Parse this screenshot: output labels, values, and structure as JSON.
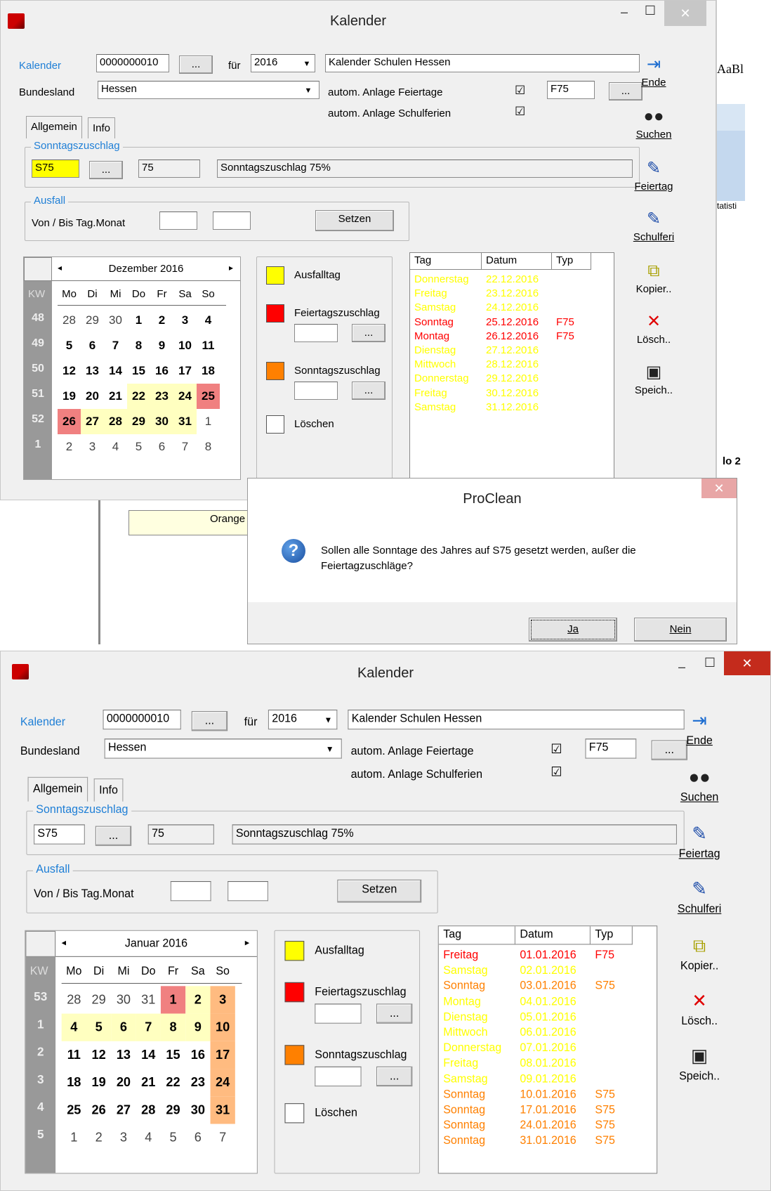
{
  "win1": {
    "title": "Kalender",
    "minimize": "‒",
    "maximize": "☐",
    "close": "✕",
    "kalender_label": "Kalender",
    "kalender_value": "0000000010",
    "browse": "...",
    "fuer_label": "für",
    "year": "2016",
    "name": "Kalender Schulen  Hessen",
    "bundesland_label": "Bundesland",
    "bundesland": "Hessen",
    "feiertage_label": "autom. Anlage Feiertage",
    "feiertage_code": "F75",
    "schulferien_label": "autom. Anlage Schulferien",
    "check": "☑",
    "tab_allgemein": "Allgemein",
    "tab_info": "Info",
    "sonntag_group": "Sonntagszuschlag",
    "sonntag_code": "S75",
    "sonntag_pct": "75",
    "sonntag_desc": "Sonntagszuschlag 75%",
    "ausfall_group": "Ausfall",
    "vonbis": "Von / Bis Tag.Monat",
    "setzen": "Setzen",
    "month": "Dezember 2016",
    "kw": "KW",
    "prev": "◂",
    "next": "▸",
    "weekdays": [
      "Mo",
      "Di",
      "Mi",
      "Do",
      "Fr",
      "Sa",
      "So"
    ],
    "weeks": [
      "48",
      "49",
      "50",
      "51",
      "52",
      "1"
    ],
    "days": [
      [
        "28",
        "29",
        "30",
        "1",
        "2",
        "3",
        "4"
      ],
      [
        "5",
        "6",
        "7",
        "8",
        "9",
        "10",
        "11"
      ],
      [
        "12",
        "13",
        "14",
        "15",
        "16",
        "17",
        "18"
      ],
      [
        "19",
        "20",
        "21",
        "22",
        "23",
        "24",
        "25"
      ],
      [
        "26",
        "27",
        "28",
        "29",
        "30",
        "31",
        "1"
      ],
      [
        "2",
        "3",
        "4",
        "5",
        "6",
        "7",
        "8"
      ]
    ],
    "legend": {
      "ausfall": "Ausfalltag",
      "feiertag": "Feiertagszuschlag",
      "sonntag": "Sonntagszuschlag",
      "loeschen": "Löschen"
    },
    "list_head": [
      "Tag",
      "Datum",
      "Typ"
    ],
    "rows": [
      [
        "Donnerstag",
        "22.12.2016",
        ""
      ],
      [
        "Freitag",
        "23.12.2016",
        ""
      ],
      [
        "Samstag",
        "24.12.2016",
        ""
      ],
      [
        "Sonntag",
        "25.12.2016",
        "F75"
      ],
      [
        "Montag",
        "26.12.2016",
        "F75"
      ],
      [
        "Dienstag",
        "27.12.2016",
        ""
      ],
      [
        "Mittwoch",
        "28.12.2016",
        ""
      ],
      [
        "Donnerstag",
        "29.12.2016",
        ""
      ],
      [
        "Freitag",
        "30.12.2016",
        ""
      ],
      [
        "Samstag",
        "31.12.2016",
        ""
      ]
    ],
    "toolbar": [
      "Ende",
      "Suchen",
      "Feiertag",
      "Schulferi",
      "Kopier..",
      "Lösch..",
      "Speich.."
    ]
  },
  "background_app": {
    "text1": "AaBl",
    "text2": "tatisti",
    "text3": "Orange",
    "col": "lo 2"
  },
  "dialog": {
    "title": "ProClean",
    "close": "✕",
    "icon": "?",
    "message": "Sollen alle Sonntage des Jahres auf S75  gesetzt werden, außer die Feiertagzuschläge?",
    "yes": "Ja",
    "no": "Nein"
  },
  "win2": {
    "title": "Kalender",
    "minimize": "‒",
    "maximize": "☐",
    "close": "✕",
    "kalender_label": "Kalender",
    "kalender_value": "0000000010",
    "browse": "...",
    "fuer_label": "für",
    "year": "2016",
    "name": "Kalender Schulen  Hessen",
    "bundesland_label": "Bundesland",
    "bundesland": "Hessen",
    "feiertage_label": "autom. Anlage Feiertage",
    "feiertage_code": "F75",
    "schulferien_label": "autom. Anlage Schulferien",
    "check": "☑",
    "tab_allgemein": "Allgemein",
    "tab_info": "Info",
    "sonntag_group": "Sonntagszuschlag",
    "sonntag_code": "S75",
    "sonntag_pct": "75",
    "sonntag_desc": "Sonntagszuschlag 75%",
    "ausfall_group": "Ausfall",
    "vonbis": "Von / Bis Tag.Monat",
    "setzen": "Setzen",
    "month": "Januar 2016",
    "kw": "KW",
    "prev": "◂",
    "next": "▸",
    "weekdays": [
      "Mo",
      "Di",
      "Mi",
      "Do",
      "Fr",
      "Sa",
      "So"
    ],
    "weeks": [
      "53",
      "1",
      "2",
      "3",
      "4",
      "5"
    ],
    "days": [
      [
        "28",
        "29",
        "30",
        "31",
        "1",
        "2",
        "3"
      ],
      [
        "4",
        "5",
        "6",
        "7",
        "8",
        "9",
        "10"
      ],
      [
        "11",
        "12",
        "13",
        "14",
        "15",
        "16",
        "17"
      ],
      [
        "18",
        "19",
        "20",
        "21",
        "22",
        "23",
        "24"
      ],
      [
        "25",
        "26",
        "27",
        "28",
        "29",
        "30",
        "31"
      ],
      [
        "1",
        "2",
        "3",
        "4",
        "5",
        "6",
        "7"
      ]
    ],
    "legend": {
      "ausfall": "Ausfalltag",
      "feiertag": "Feiertagszuschlag",
      "sonntag": "Sonntagszuschlag",
      "loeschen": "Löschen"
    },
    "list_head": [
      "Tag",
      "Datum",
      "Typ"
    ],
    "rows": [
      [
        "Freitag",
        "01.01.2016",
        "F75"
      ],
      [
        "Samstag",
        "02.01.2016",
        ""
      ],
      [
        "Sonntag",
        "03.01.2016",
        "S75"
      ],
      [
        "Montag",
        "04.01.2016",
        ""
      ],
      [
        "Dienstag",
        "05.01.2016",
        ""
      ],
      [
        "Mittwoch",
        "06.01.2016",
        ""
      ],
      [
        "Donnerstag",
        "07.01.2016",
        ""
      ],
      [
        "Freitag",
        "08.01.2016",
        ""
      ],
      [
        "Samstag",
        "09.01.2016",
        ""
      ],
      [
        "Sonntag",
        "10.01.2016",
        "S75"
      ],
      [
        "Sonntag",
        "17.01.2016",
        "S75"
      ],
      [
        "Sonntag",
        "24.01.2016",
        "S75"
      ],
      [
        "Sonntag",
        "31.01.2016",
        "S75"
      ]
    ],
    "toolbar": [
      "Ende",
      "Suchen",
      "Feiertag",
      "Schulferi",
      "Kopier..",
      "Lösch..",
      "Speich.."
    ]
  },
  "colors": {
    "yellow": "#ffff00",
    "red": "#ff0000",
    "orange": "#ff8000",
    "pale_yellow": "#ffffc0",
    "pale_red": "#f08080",
    "pale_orange": "#ffbb80",
    "row_yellow": "#ffff00",
    "row_red": "#ff0000",
    "row_orange": "#ff8000"
  }
}
